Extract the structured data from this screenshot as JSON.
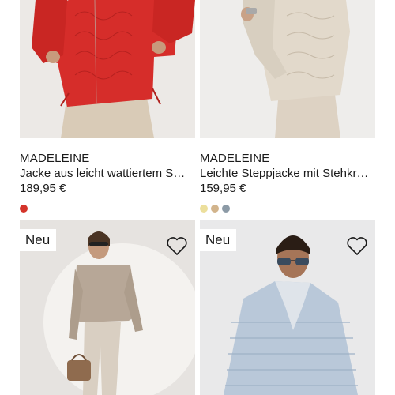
{
  "products": [
    {
      "brand": "MADELEINE",
      "title": "Jacke aus leicht wattiertem S…",
      "price": "189,95 €",
      "swatches": [
        "#d4342a"
      ]
    },
    {
      "brand": "MADELEINE",
      "title": "Leichte Steppjacke mit Stehkr…",
      "price": "159,95 €",
      "swatches": [
        "#ecdf9c",
        "#d2b48c",
        "#8c9aa6"
      ]
    },
    {
      "badge": "Neu",
      "favorite": false,
      "icon": "heart-outline-icon"
    },
    {
      "badge": "Neu",
      "favorite": false,
      "icon": "heart-outline-icon"
    }
  ],
  "colors": {
    "text": "#1a1a1a",
    "photo_bg_red_jacket": "#ece9e6",
    "photo_bg_beige_jacket": "#eeedeb",
    "photo_bg_taupe_look": "#e6e3e0",
    "photo_bg_blue_jacket": "#e9e9ea"
  }
}
